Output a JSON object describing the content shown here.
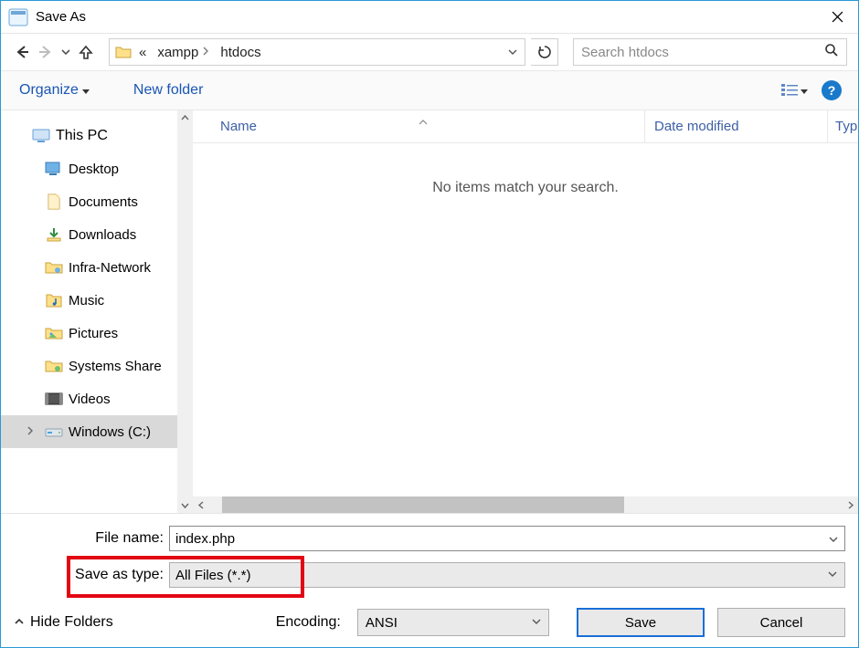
{
  "window": {
    "title": "Save As"
  },
  "nav": {
    "breadcrumb_prefix_glyph": "«",
    "segments": [
      "xampp",
      "htdocs"
    ],
    "refresh_icon": "refresh-icon"
  },
  "search": {
    "placeholder": "Search htdocs"
  },
  "toolbar": {
    "organize_label": "Organize",
    "newfolder_label": "New folder",
    "help_glyph": "?"
  },
  "tree": {
    "root_label": "This PC",
    "items": [
      {
        "label": "Desktop",
        "icon": "desktop-icon"
      },
      {
        "label": "Documents",
        "icon": "documents-icon"
      },
      {
        "label": "Downloads",
        "icon": "downloads-icon"
      },
      {
        "label": "Infra-Network",
        "icon": "network-folder-icon"
      },
      {
        "label": "Music",
        "icon": "music-icon"
      },
      {
        "label": "Pictures",
        "icon": "pictures-icon"
      },
      {
        "label": "Systems Share",
        "icon": "share-folder-icon"
      },
      {
        "label": "Videos",
        "icon": "videos-icon"
      },
      {
        "label": "Windows (C:)",
        "icon": "drive-icon",
        "selected": true,
        "expandable": true
      }
    ]
  },
  "columns": {
    "name": "Name",
    "date_modified": "Date modified",
    "type": "Typ"
  },
  "list_empty_message": "No items match your search.",
  "filename": {
    "label": "File name:",
    "value": "index.php"
  },
  "filetype": {
    "label": "Save as type:",
    "value": "All Files  (*.*)"
  },
  "encoding": {
    "label": "Encoding:",
    "value": "ANSI"
  },
  "buttons": {
    "save": "Save",
    "cancel": "Cancel"
  },
  "hide_folders_label": "Hide Folders"
}
